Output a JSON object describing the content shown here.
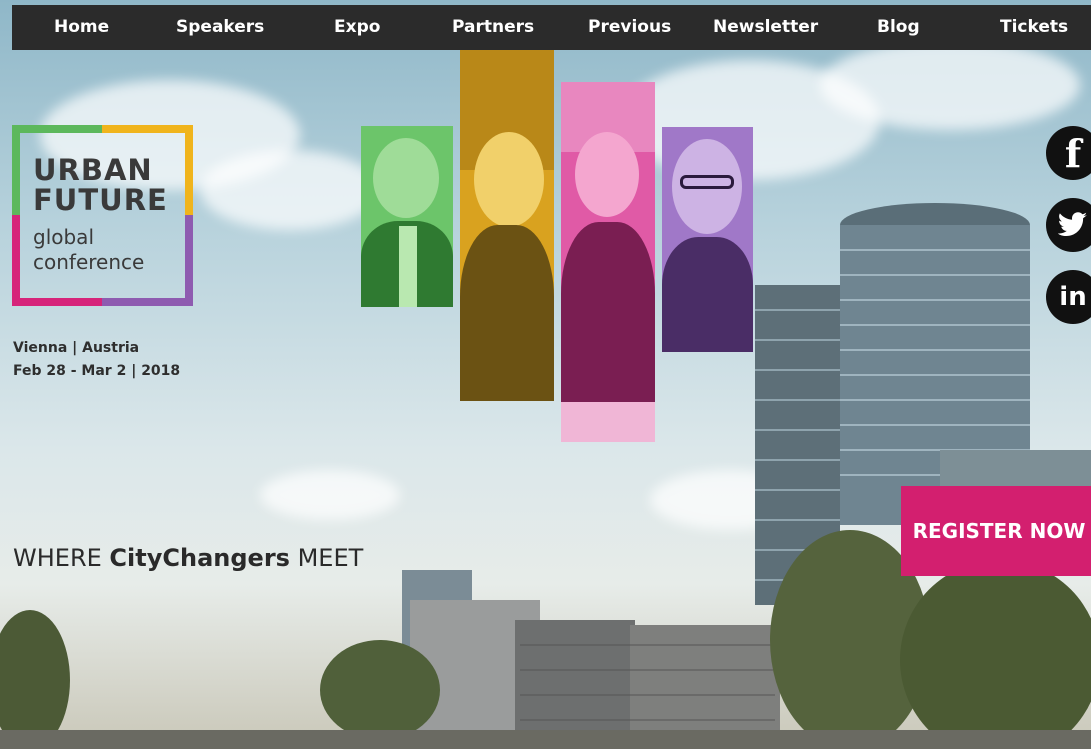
{
  "nav": {
    "items": [
      {
        "label": "Home"
      },
      {
        "label": "Speakers"
      },
      {
        "label": "Expo"
      },
      {
        "label": "Partners"
      },
      {
        "label": "Previous"
      },
      {
        "label": "Newsletter"
      },
      {
        "label": "Blog"
      },
      {
        "label": "Tickets"
      }
    ]
  },
  "logo": {
    "line1": "URBAN",
    "line2": "FUTURE",
    "line3": "global",
    "line4": "conference",
    "colors": {
      "green": "#5cb85c",
      "yellow": "#f0b41c",
      "magenta": "#d6247a",
      "purple": "#8e5bb0"
    }
  },
  "event": {
    "location": "Vienna | Austria",
    "dates": "Feb 28 - Mar 2 | 2018"
  },
  "tagline": {
    "prefix": "WHERE ",
    "brand": "CityChangers",
    "suffix": " MEET"
  },
  "cta": {
    "register_label": "REGISTER NOW",
    "color": "#d31f6f"
  },
  "social": {
    "facebook": "f",
    "twitter": "🐦",
    "linkedin": "in"
  }
}
